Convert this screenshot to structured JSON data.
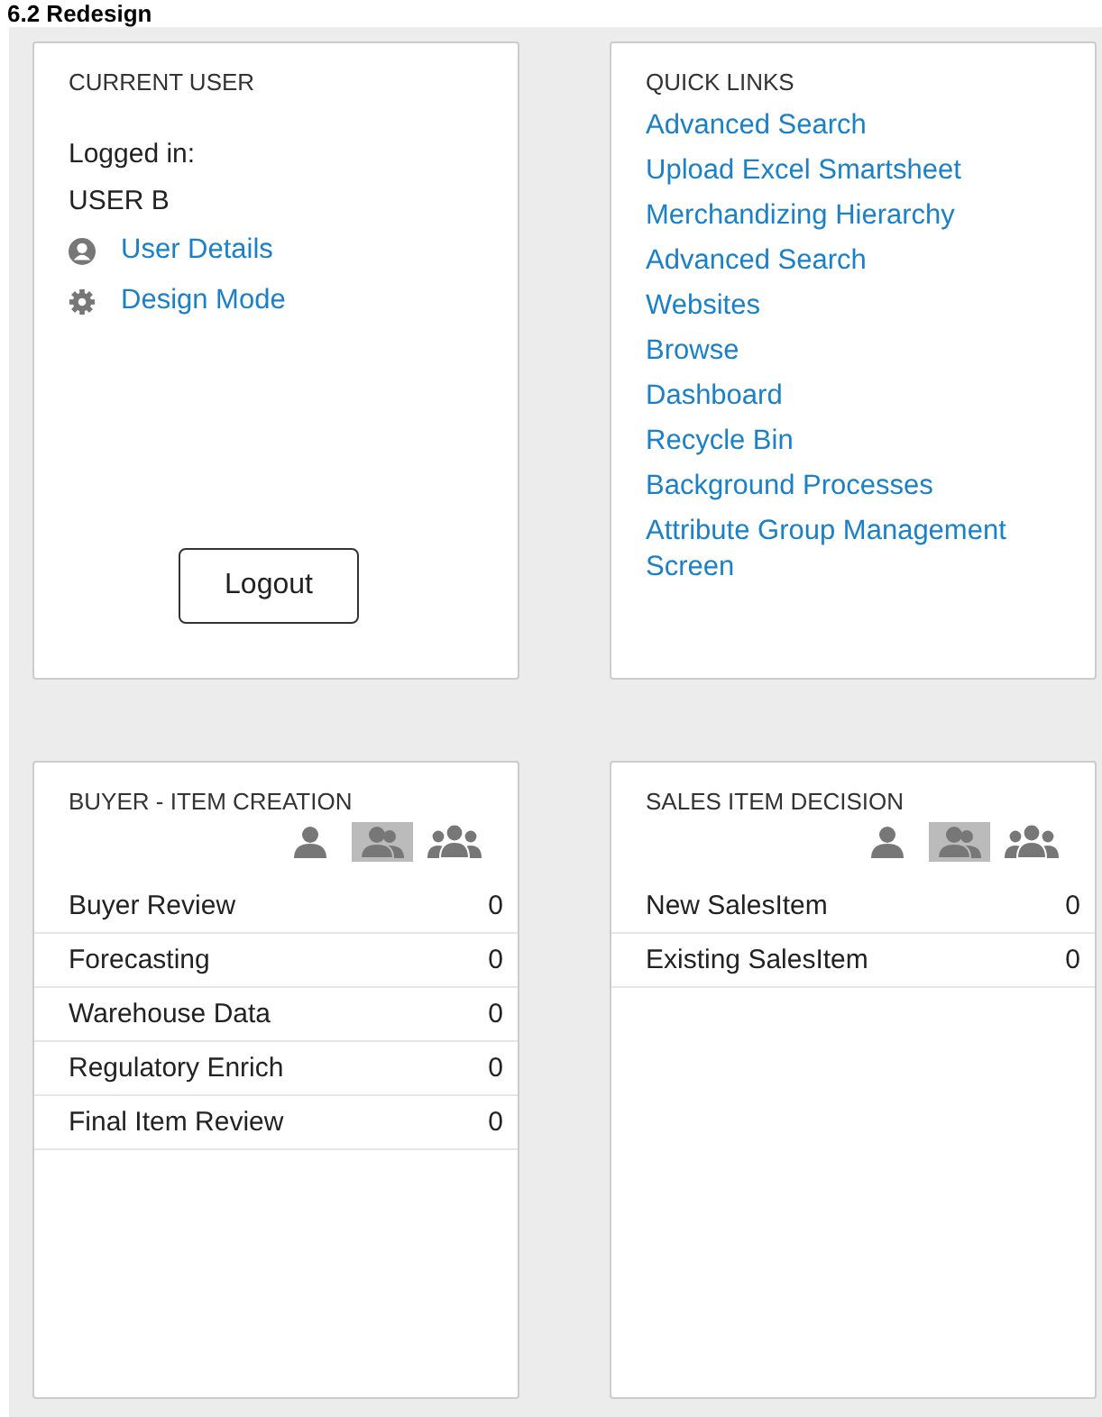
{
  "heading": "6.2 Redesign",
  "current_user": {
    "title": "CURRENT USER",
    "logged_in_label": "Logged in:",
    "user_name": "USER B",
    "links": [
      {
        "kind": "user",
        "label": "User Details"
      },
      {
        "kind": "gear",
        "label": "Design Mode"
      }
    ],
    "logout_button": "Logout"
  },
  "quick_links": {
    "title": "QUICK LINKS",
    "links": [
      "Advanced Search",
      "Upload Excel Smartsheet",
      "Merchandizing Hierarchy",
      "Advanced Search",
      "Websites",
      "Browse",
      "Dashboard",
      "Recycle Bin",
      "Background Processes",
      "Attribute Group Management Screen"
    ]
  },
  "workflows": [
    {
      "title": "BUYER - ITEM CREATION",
      "scopes": [
        {
          "kind": "one",
          "selected": false
        },
        {
          "kind": "two",
          "selected": true
        },
        {
          "kind": "group",
          "selected": false
        }
      ],
      "rows": [
        {
          "label": "Buyer Review",
          "count": "0"
        },
        {
          "label": "Forecasting",
          "count": "0"
        },
        {
          "label": "Warehouse Data",
          "count": "0"
        },
        {
          "label": "Regulatory Enrich",
          "count": "0"
        },
        {
          "label": "Final Item Review",
          "count": "0"
        }
      ]
    },
    {
      "title": "SALES ITEM DECISION",
      "scopes": [
        {
          "kind": "one",
          "selected": false
        },
        {
          "kind": "two",
          "selected": true
        },
        {
          "kind": "group",
          "selected": false
        }
      ],
      "rows": [
        {
          "label": "New SalesItem",
          "count": "0"
        },
        {
          "label": "Existing SalesItem",
          "count": "0"
        }
      ]
    }
  ]
}
